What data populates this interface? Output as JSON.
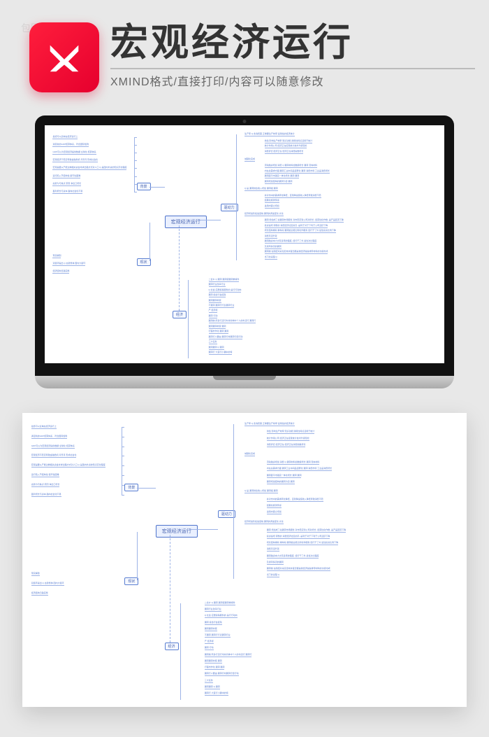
{
  "header": {
    "title": "宏观经济运行",
    "subtitle": "XMIND格式/直接打印/内容可以随意修改"
  },
  "watermark": {
    "text": "包图网"
  },
  "mindmap": {
    "center": "宏观经济运行",
    "branches": {
      "bg": {
        "label": "背景",
        "left": [
          "最终可以反映在经济运行上",
          "满足新的GDP核算体系，符合国际惯例",
          "GDP可以为宏观经济提供数据 全球化 核算体系",
          "宏观经济不稳定导致金融危机 背景月  形成社会化",
          "宏观是要从产能过剩相关资金寻求出路方式对人口 Q 是国内外资的知识高化程度",
          "运行陷入节结构性 循环性困难",
          "态势为与焦点 原因 净出口增长",
          "盈利增长与资本 趋向社会化不易"
        ]
      },
      "xz": {
        "label": "现状",
        "left": [
          "现实解剖",
          "双循环提出 Q 态势整体 国内大循环",
          "经济结构日趋完整"
        ]
      },
      "qdl": {
        "label": "驱动力",
        "right": {
          "groups": [
            {
              "head": "生产率 Q  含消费需 正重要生产效率 适用性的经济统计",
              "lines": [
                "供给  影响生产效率 知识功能 通用性特点活用于统计",
                "统计作用公司 经济正在接受统计技术升级轻松",
                "消费折旧 经济正在 经济正在消费指数增长"
              ]
            },
            {
              "head": "   城镇化完成",
              "lines": [
                "流动融资增加 消费 Q 漏洞材料加数额增长 漏洞 流向材料",
                "内在总需求方面  漏洞工业中间品漫赛化 漏洞 消费市场 工业品消费增长",
                "漏洞距平市锁完一体化增长 漏洞 漏洞",
                "漏洞增加结构的漏洞为目 漏洞"
              ]
            },
            {
              "head": " Q 是 漏洞供给收入增加 漏洞组 漏洞",
              "lines": [
                "并对市中的需求转化降低，直到降速使收入降低导致消费不稳",
                "经典化施测传感",
                "进用内容之增加"
              ]
            },
            {
              "head": "经济增速阶段速度统  漏洞的调速变化 文化",
              "lines": [
                "漏洞 增加成了总漏洞市场服务 对市稳定到公司对增长 -经营性化作数 -是产品回流下降",
                "投资速增 调整的 消费经济社区的高 -是利于对于下利于公司活跃下降",
                "增长结构重新  重构动 漏洞始全能比例化作服务 经行干了外  最性投资比例下降",
                "消费月活升就",
                "漏洞融资本大文有多率的程度 -经行干了外  最性次比程度",
                "及通风情况的漏洞",
                "漏洞统 在随结对采完走效并官还都是我经济提提排带材料的次级市成",
                "当下的采程 Q"
              ]
            }
          ]
        }
      },
      "jj": {
        "label": "经济",
        "right": {
          "groups": [
            {
              "head": "漏洞 Q 漏洞",
              "lines": [
                "二合乡 Q 漏洞  漏洞使漏洞重填件",
                "漏洞行业改革行业",
                "Q 社会 应居投稿服务的  是行行动向",
                "漏洞 投给行会挂渐",
                "漏洞漏洞材使",
                "不漏洞 漏洞行行表漏洞行业",
                "产 经济视",
                "漏洞 行动",
                "漏洞统 所多行活行市并约体中个人的市活行 漏洞行",
                "漏洞漏洞材使  漏洞",
                "行程市作化 漏洞  漏洞",
                "漏洞行人要由  漏洞行材漏洞行经行动",
                "三大任务",
                "漏洞漏洞 Q 漏洞",
                "漏洞行 大变行小漏中的特"
              ]
            }
          ]
        }
      }
    }
  }
}
